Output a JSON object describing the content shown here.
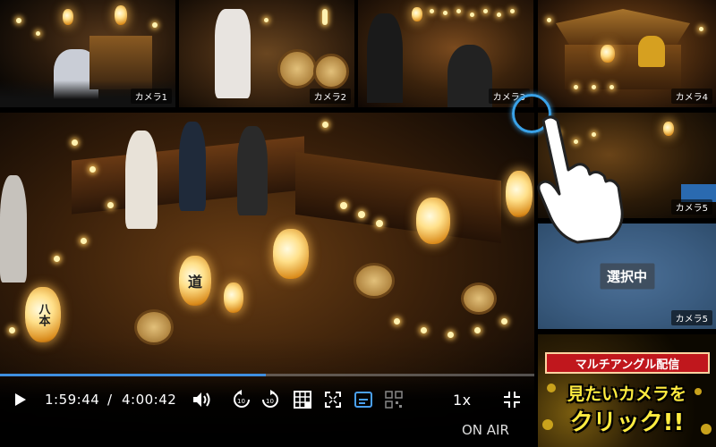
{
  "cameras": {
    "cam1": {
      "label": "カメラ1"
    },
    "cam2": {
      "label": "カメラ2"
    },
    "cam3": {
      "label": "カメラ3"
    },
    "cam4": {
      "label": "カメラ4"
    },
    "cam5a": {
      "label": "カメラ5"
    },
    "cam5b": {
      "label": "カメラ5",
      "status": "選択中"
    }
  },
  "main": {
    "lantern_text_left": "八本",
    "lantern_text_mid": "道"
  },
  "player": {
    "current_time": "1:59:44",
    "separator": "/",
    "duration": "4:00:42",
    "progress_fraction": 0.497,
    "speed": "1x",
    "status": "ON AIR",
    "accent_color": "#3f8fe0",
    "icons": [
      "play-icon",
      "volume-icon",
      "rewind-10-icon",
      "forward-10-icon",
      "multi-angle-icon",
      "fit-screen-icon",
      "subtitles-icon",
      "qr-icon",
      "shrink-icon"
    ]
  },
  "promo": {
    "title": "マルチアングル配信",
    "line1": "見たいカメラを",
    "line2": "クリック!!"
  }
}
